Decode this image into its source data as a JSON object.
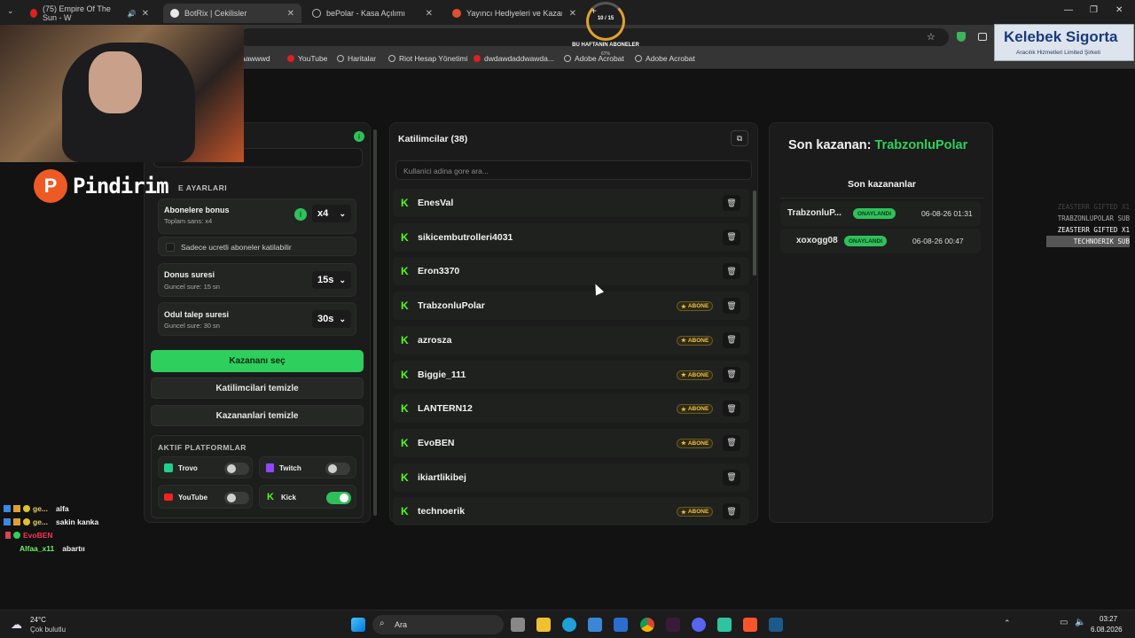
{
  "tabs": [
    {
      "title": "(75) Empire Of The Sun - W",
      "color": "#e02020"
    },
    {
      "title": "BotRix | Cekilisler",
      "color": "#e8e8e8"
    },
    {
      "title": "bePolar - Kasa Açılımı",
      "color": "#bbbbbb"
    },
    {
      "title": "Yayıncı Hediyeleri ve Kazananlar",
      "color": "#e05030"
    }
  ],
  "overlay": {
    "progress_text": "10 / 15",
    "weekly_label": "BU HAFTANIN ABONELER",
    "percent": "67%",
    "sponsor_name": "Kelebek Sigorta",
    "sponsor_sub": "Aracılık Hizmetleri Limited Şirketi",
    "logo_text": "Pindirim",
    "ticker": [
      "ZEASTERR GIFTED X1",
      "TRABZONLUPOLAR SUB",
      "ZEASTERR GIFTED X1",
      "TECHNOERIK SUB"
    ]
  },
  "bookmarks": [
    "aawwwd",
    "YouTube",
    "Haritalar",
    "Riot Hesap Yönetimi",
    "dwdawdaddwawda...",
    "Adobe Acrobat",
    "Adobe Acrobat"
  ],
  "settings": {
    "section_title": "E AYARLARI",
    "sub_bonus": {
      "label": "Abonelere bonus",
      "sub": "Toplam sans: x4",
      "value": "x4"
    },
    "paid_only": "Sadece ucretli aboneler katilabilir",
    "bonus_time": {
      "label": "Donus suresi",
      "sub": "Guncel sure: 15 sn",
      "value": "15s"
    },
    "claim_time": {
      "label": "Odul talep suresi",
      "sub": "Guncel sure: 30 sn",
      "value": "30s"
    },
    "pick_winner": "Kazananı seç",
    "clear_participants": "Katilimcilari temizle",
    "clear_winners": "Kazananlari temizle",
    "platforms_title": "AKTIF PLATFORMLAR",
    "platforms": [
      {
        "name": "Trovo",
        "on": false,
        "color": "#1fd18a"
      },
      {
        "name": "Twitch",
        "on": false,
        "color": "#9146ff"
      },
      {
        "name": "YouTube",
        "on": false,
        "color": "#ff2020"
      },
      {
        "name": "Kick",
        "on": true,
        "color": "#53fc18"
      }
    ]
  },
  "participants": {
    "title": "Katilimcilar (38)",
    "search_placeholder": "Kullanici adina gore ara...",
    "badge_label": "ABONE",
    "list": [
      {
        "name": "EnesVal",
        "sub": false
      },
      {
        "name": "sikicembutrolleri4031",
        "sub": false
      },
      {
        "name": "Eron3370",
        "sub": false
      },
      {
        "name": "TrabzonluPolar",
        "sub": true
      },
      {
        "name": "azrosza",
        "sub": true
      },
      {
        "name": "Biggie_111",
        "sub": true
      },
      {
        "name": "LANTERN12",
        "sub": true
      },
      {
        "name": "EvoBEN",
        "sub": true
      },
      {
        "name": "ikiartlikibej",
        "sub": false
      },
      {
        "name": "technoerik",
        "sub": true
      }
    ]
  },
  "winners": {
    "last_label": "Son kazanan:",
    "last_name": "TrabzonluPolar",
    "list_title": "Son kazananlar",
    "approved_label": "ONAYLANDI",
    "rows": [
      {
        "name": "TrabzonluP...",
        "date": "06-08-26 01:31"
      },
      {
        "name": "xoxogg08",
        "date": "06-08-26 00:47"
      }
    ]
  },
  "chat": [
    {
      "user": "ge...",
      "msg": "alfa",
      "color": "#e8d060"
    },
    {
      "user": "ge...",
      "msg": "sakin kanka",
      "color": "#e8d060"
    },
    {
      "user": "EvoBEN",
      "msg": "",
      "color": "#ff3355"
    },
    {
      "user": "Alfaa_x11",
      "msg": "abartıı",
      "color": "#6cf26c"
    }
  ],
  "taskbar": {
    "weather_temp": "24°C",
    "weather_desc": "Çok bulutlu",
    "search": "Ara",
    "time": "03:27",
    "date": "6.08.2026"
  }
}
